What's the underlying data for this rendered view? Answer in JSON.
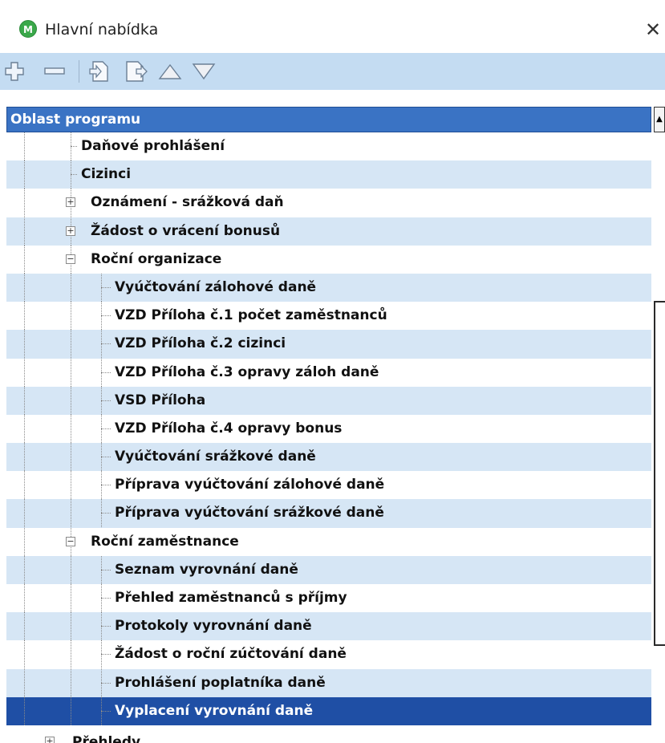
{
  "window": {
    "title": "Hlavní nabídka",
    "app_icon_letter": "M",
    "close_glyph": "✕"
  },
  "toolbar": {
    "buttons": [
      {
        "icon": "plus-icon"
      },
      {
        "icon": "minus-icon"
      },
      {
        "icon": "new-item-icon"
      },
      {
        "icon": "edit-item-icon"
      },
      {
        "icon": "move-up-icon"
      },
      {
        "icon": "move-down-icon"
      }
    ]
  },
  "tree": {
    "header": "Oblast programu",
    "items": [
      {
        "label": "Daňové prohlášení",
        "level": 1,
        "expander": ""
      },
      {
        "label": "Cizinci",
        "level": 1,
        "expander": ""
      },
      {
        "label": "Oznámení - srážková daň",
        "level": 1,
        "expander": "+"
      },
      {
        "label": "Žádost o vrácení bonusů",
        "level": 1,
        "expander": "+"
      },
      {
        "label": "Roční organizace",
        "level": 1,
        "expander": "−"
      },
      {
        "label": "Vyúčtování zálohové daně",
        "level": 2,
        "expander": ""
      },
      {
        "label": "VZD Příloha č.1 počet zaměstnanců",
        "level": 2,
        "expander": ""
      },
      {
        "label": "VZD Příloha č.2 cizinci",
        "level": 2,
        "expander": ""
      },
      {
        "label": "VZD Příloha č.3 opravy záloh daně",
        "level": 2,
        "expander": ""
      },
      {
        "label": "VSD Příloha",
        "level": 2,
        "expander": ""
      },
      {
        "label": "VZD Příloha č.4 opravy bonus",
        "level": 2,
        "expander": ""
      },
      {
        "label": "Vyúčtování srážkové daně",
        "level": 2,
        "expander": ""
      },
      {
        "label": "Příprava vyúčtování zálohové daně",
        "level": 2,
        "expander": ""
      },
      {
        "label": "Příprava vyúčtování srážkové daně",
        "level": 2,
        "expander": ""
      },
      {
        "label": "Roční zaměstnance",
        "level": 1,
        "expander": "−"
      },
      {
        "label": "Seznam vyrovnání daně",
        "level": 2,
        "expander": ""
      },
      {
        "label": "Přehled zaměstnanců s příjmy",
        "level": 2,
        "expander": ""
      },
      {
        "label": "Protokoly vyrovnání daně",
        "level": 2,
        "expander": ""
      },
      {
        "label": "Žádost o roční zúčtování daně",
        "level": 2,
        "expander": ""
      },
      {
        "label": "Prohlášení poplatníka daně",
        "level": 2,
        "expander": ""
      },
      {
        "label": "Vyplacení vyrovnání daně",
        "level": 2,
        "expander": "",
        "selected": true
      }
    ],
    "partial_bottom": {
      "label": "Přehledy",
      "expander": "+"
    }
  },
  "colors": {
    "toolbar_bg": "#c4dcf2",
    "header_bg": "#3a73c4",
    "row_alt": "#d6e6f5",
    "selected_bg": "#1f4fa5"
  }
}
